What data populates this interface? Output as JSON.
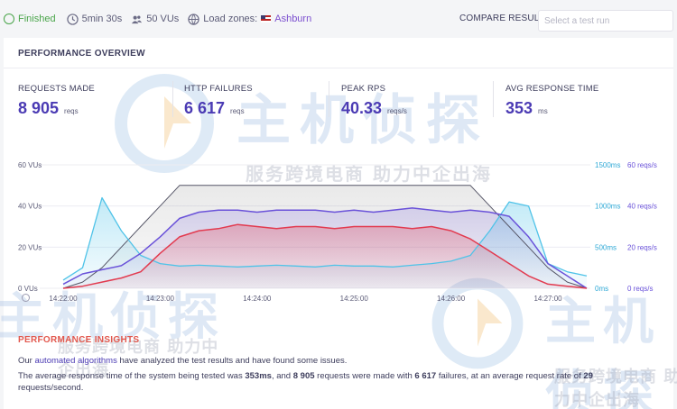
{
  "topbar": {
    "status": "Finished",
    "duration": "5min 30s",
    "vus": "50 VUs",
    "load_zones_label": "Load zones:",
    "load_zone": "Ashburn",
    "compare_label": "COMPARE RESULT",
    "select_placeholder": "Select a test run"
  },
  "overview": {
    "title": "PERFORMANCE OVERVIEW",
    "stats": [
      {
        "label": "REQUESTS MADE",
        "value": "8 905",
        "unit": "reqs"
      },
      {
        "label": "HTTP FAILURES",
        "value": "6 617",
        "unit": "reqs"
      },
      {
        "label": "PEAK RPS",
        "value": "40.33",
        "unit": "reqs/s"
      },
      {
        "label": "AVG RESPONSE TIME",
        "value": "353",
        "unit": "ms"
      }
    ]
  },
  "watermark": {
    "brand": "主机侦探",
    "slogan": "服务跨境电商 助力中企出海"
  },
  "colors": {
    "vus": "#555566",
    "response_time": "#4fc3e8",
    "rps": "#6a52d9",
    "failures": "#e23a4f"
  },
  "chart_data": {
    "type": "line",
    "x_ticks": [
      "14:22:00",
      "14:23:00",
      "14:24:00",
      "14:25:00",
      "14:26:00",
      "14:27:00"
    ],
    "left_axis": {
      "ticks": [
        "60 VUs",
        "40 VUs",
        "20 VUs",
        "0 VUs"
      ],
      "ylim": [
        0,
        60
      ]
    },
    "right_axis_ms": {
      "ticks": [
        "1500ms",
        "1000ms",
        "500ms",
        "0ms"
      ],
      "ylim": [
        0,
        1500
      ]
    },
    "right_axis_rps": {
      "ticks": [
        "60 reqs/s",
        "40 reqs/s",
        "20 reqs/s",
        "0 reqs/s"
      ],
      "ylim": [
        0,
        60
      ]
    },
    "x_minutes": [
      0,
      0.2,
      0.4,
      0.6,
      0.8,
      1.0,
      1.2,
      1.4,
      1.6,
      1.8,
      2.0,
      2.2,
      2.4,
      2.6,
      2.8,
      3.0,
      3.2,
      3.4,
      3.6,
      3.8,
      4.0,
      4.2,
      4.4,
      4.6,
      4.8,
      5.0,
      5.2,
      5.4
    ],
    "series": [
      {
        "name": "VUs",
        "axis": "left",
        "values": [
          0,
          3,
          10,
          20,
          30,
          40,
          50,
          50,
          50,
          50,
          50,
          50,
          50,
          50,
          50,
          50,
          50,
          50,
          50,
          50,
          50,
          50,
          40,
          30,
          20,
          10,
          3,
          0
        ]
      },
      {
        "name": "Response time",
        "axis": "right_ms",
        "values": [
          100,
          250,
          1100,
          700,
          400,
          300,
          270,
          280,
          270,
          260,
          270,
          280,
          270,
          260,
          280,
          270,
          270,
          260,
          280,
          300,
          330,
          400,
          700,
          1050,
          1000,
          300,
          200,
          150
        ]
      },
      {
        "name": "Requests/s",
        "axis": "right_rps",
        "values": [
          2,
          7,
          9,
          11,
          17,
          25,
          34,
          37,
          38,
          38,
          37,
          38,
          38,
          38,
          37,
          38,
          37,
          38,
          39,
          38,
          37,
          38,
          37,
          35,
          25,
          12,
          6,
          0
        ]
      },
      {
        "name": "Failures/s",
        "axis": "right_rps",
        "values": [
          0,
          1,
          3,
          5,
          8,
          17,
          25,
          28,
          29,
          31,
          30,
          29,
          30,
          30,
          29,
          30,
          30,
          30,
          29,
          30,
          28,
          24,
          18,
          12,
          6,
          2,
          1,
          0
        ]
      }
    ]
  },
  "insights": {
    "title": "PERFORMANCE INSIGHTS",
    "p1_a": "Our ",
    "p1_link": "automated algorithms",
    "p1_b": " have analyzed the test results and have found some issues.",
    "p2_a": "The average response time of the system being tested was ",
    "p2_rt": "353ms",
    "p2_b": ", and ",
    "p2_reqs": "8 905",
    "p2_c": " requests were made with ",
    "p2_fail": "6 617",
    "p2_d": " failures, at an average request rate of ",
    "p2_rate": "29",
    "p2_e": "requests/second."
  }
}
